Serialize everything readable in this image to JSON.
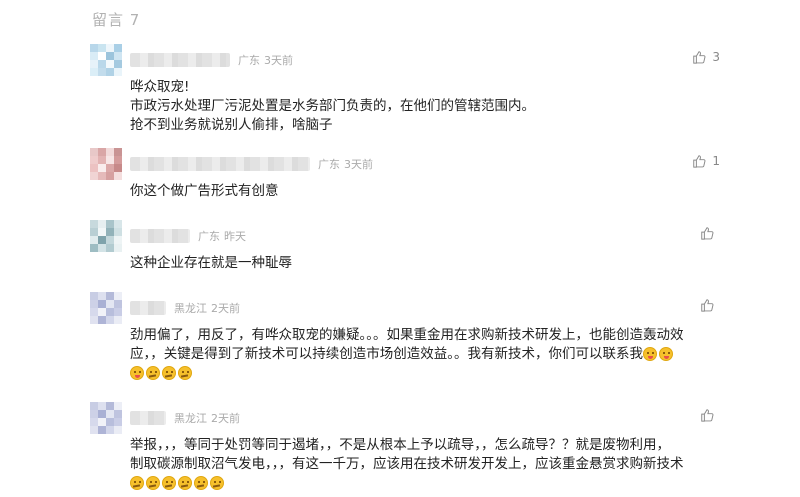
{
  "header": {
    "title": "留言 7"
  },
  "comments": [
    {
      "location": "广东",
      "time": "3天前",
      "likes": "3",
      "lines": [
        "哗众取宠!",
        "市政污水处理厂污泥处置是水务部门负责的，在他们的管辖范围内。",
        "抢不到业务就说别人偷排，啥脑子"
      ],
      "avatar_colors": [
        "#b8d7ea",
        "#c9e4f0",
        "#eef6fb",
        "#a9cfe6",
        "#d9ecf6",
        "#ffffff",
        "#9cc4dc",
        "#cfe5f2",
        "#e7f2f9",
        "#bad8ea",
        "#f3f9fc",
        "#a5cae0",
        "#dbeef7",
        "#c2dcec",
        "#b0d2e6",
        "#e9f4fa"
      ]
    },
    {
      "location": "广东",
      "time": "3天前",
      "likes": "1",
      "lines": [
        "你这个做广告形式有创意"
      ],
      "avatar_colors": [
        "#e8c8c8",
        "#d9a6a6",
        "#f2dada",
        "#c99494",
        "#efcccc",
        "#e2b3b3",
        "#f7e6e6",
        "#d49c9c",
        "#ecc2c2",
        "#f9eded",
        "#dba8a8",
        "#c78a8a",
        "#f0d4d4",
        "#e5baba",
        "#d6a0a0",
        "#f4dede"
      ]
    },
    {
      "location": "广东",
      "time": "昨天",
      "likes": "",
      "lines": [
        "这种企业存在就是一种耻辱"
      ],
      "avatar_colors": [
        "#c7d9dd",
        "#e7eff1",
        "#a9c4ca",
        "#d8e6e9",
        "#b9cfd4",
        "#f2f7f8",
        "#92b2b9",
        "#cfe0e3",
        "#e1ecee",
        "#7fa3ab",
        "#c3d7db",
        "#eef4f5",
        "#9ebdc3",
        "#d3e3e6",
        "#b2cbd0",
        "#e9f1f2"
      ]
    },
    {
      "location": "黑龙江",
      "time": "2天前",
      "likes": "",
      "lines": [
        "劲用偏了，用反了，有哗众取宠的嫌疑。。。如果重金用在求购新技术研发上，也能创造轰动效",
        "应，，关键是得到了新技术可以持续创造市场创造效益。。我有新技术，你们可以联系我"
      ],
      "emojis_line2": [
        "squinting-tongue-emoji",
        "squinting-tongue-emoji"
      ],
      "emojis_line3": [
        "squinting-tongue-emoji",
        "thinking-emoji",
        "thinking-emoji",
        "thinking-emoji"
      ],
      "avatar_colors": [
        "#c8cde4",
        "#dde0ef",
        "#b4bad9",
        "#eceef6",
        "#cdd1e7",
        "#a9b0d4",
        "#e3e6f2",
        "#bfc4df",
        "#d6d9ec",
        "#f1f2f8",
        "#b8bedc",
        "#c9cde6",
        "#e0e2f0",
        "#aeb4d6",
        "#d2d6ea",
        "#eaecf5"
      ]
    },
    {
      "location": "黑龙江",
      "time": "2天前",
      "likes": "",
      "lines": [
        "举报，，，等同于处罚等同于遏堵，，不是从根本上予以疏导，，怎么疏导？？就是废物利用，",
        "制取碳源制取沼气发电，，，有这一千万，应该用在技术研发开发上，应该重金悬赏求购新技术"
      ],
      "emojis_line3": [
        "thinking-emoji",
        "thinking-emoji",
        "thinking-emoji",
        "thinking-emoji",
        "thinking-emoji",
        "thinking-emoji"
      ],
      "avatar_colors": [
        "#c8cde4",
        "#dde0ef",
        "#b4bad9",
        "#eceef6",
        "#cdd1e7",
        "#a9b0d4",
        "#e3e6f2",
        "#bfc4df",
        "#d6d9ec",
        "#f1f2f8",
        "#b8bedc",
        "#c9cde6",
        "#e0e2f0",
        "#aeb4d6",
        "#d2d6ea",
        "#eaecf5"
      ]
    }
  ]
}
